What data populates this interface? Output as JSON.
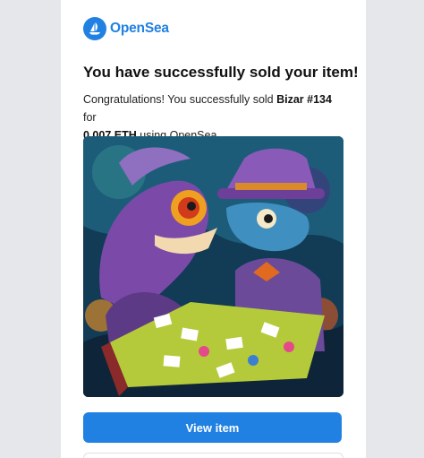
{
  "brand": {
    "name": "OpenSea",
    "logo_icon": "opensea-sailboat-logo",
    "color": "#2081e2"
  },
  "email": {
    "title": "You have successfully sold your item!",
    "body": {
      "lead": "Congratulations! You successfully sold ",
      "item_name": "Bizar #134",
      "mid": " for",
      "price": "0.007 ETH",
      "tail": " using OpenSea."
    },
    "image_alt": "Bizar #134 NFT artwork: two creatures playing cards",
    "primary_button": "View item"
  },
  "colors": {
    "button_bg": "#2081e2",
    "page_bg": "#e5e7eb",
    "card_bg": "#ffffff"
  }
}
